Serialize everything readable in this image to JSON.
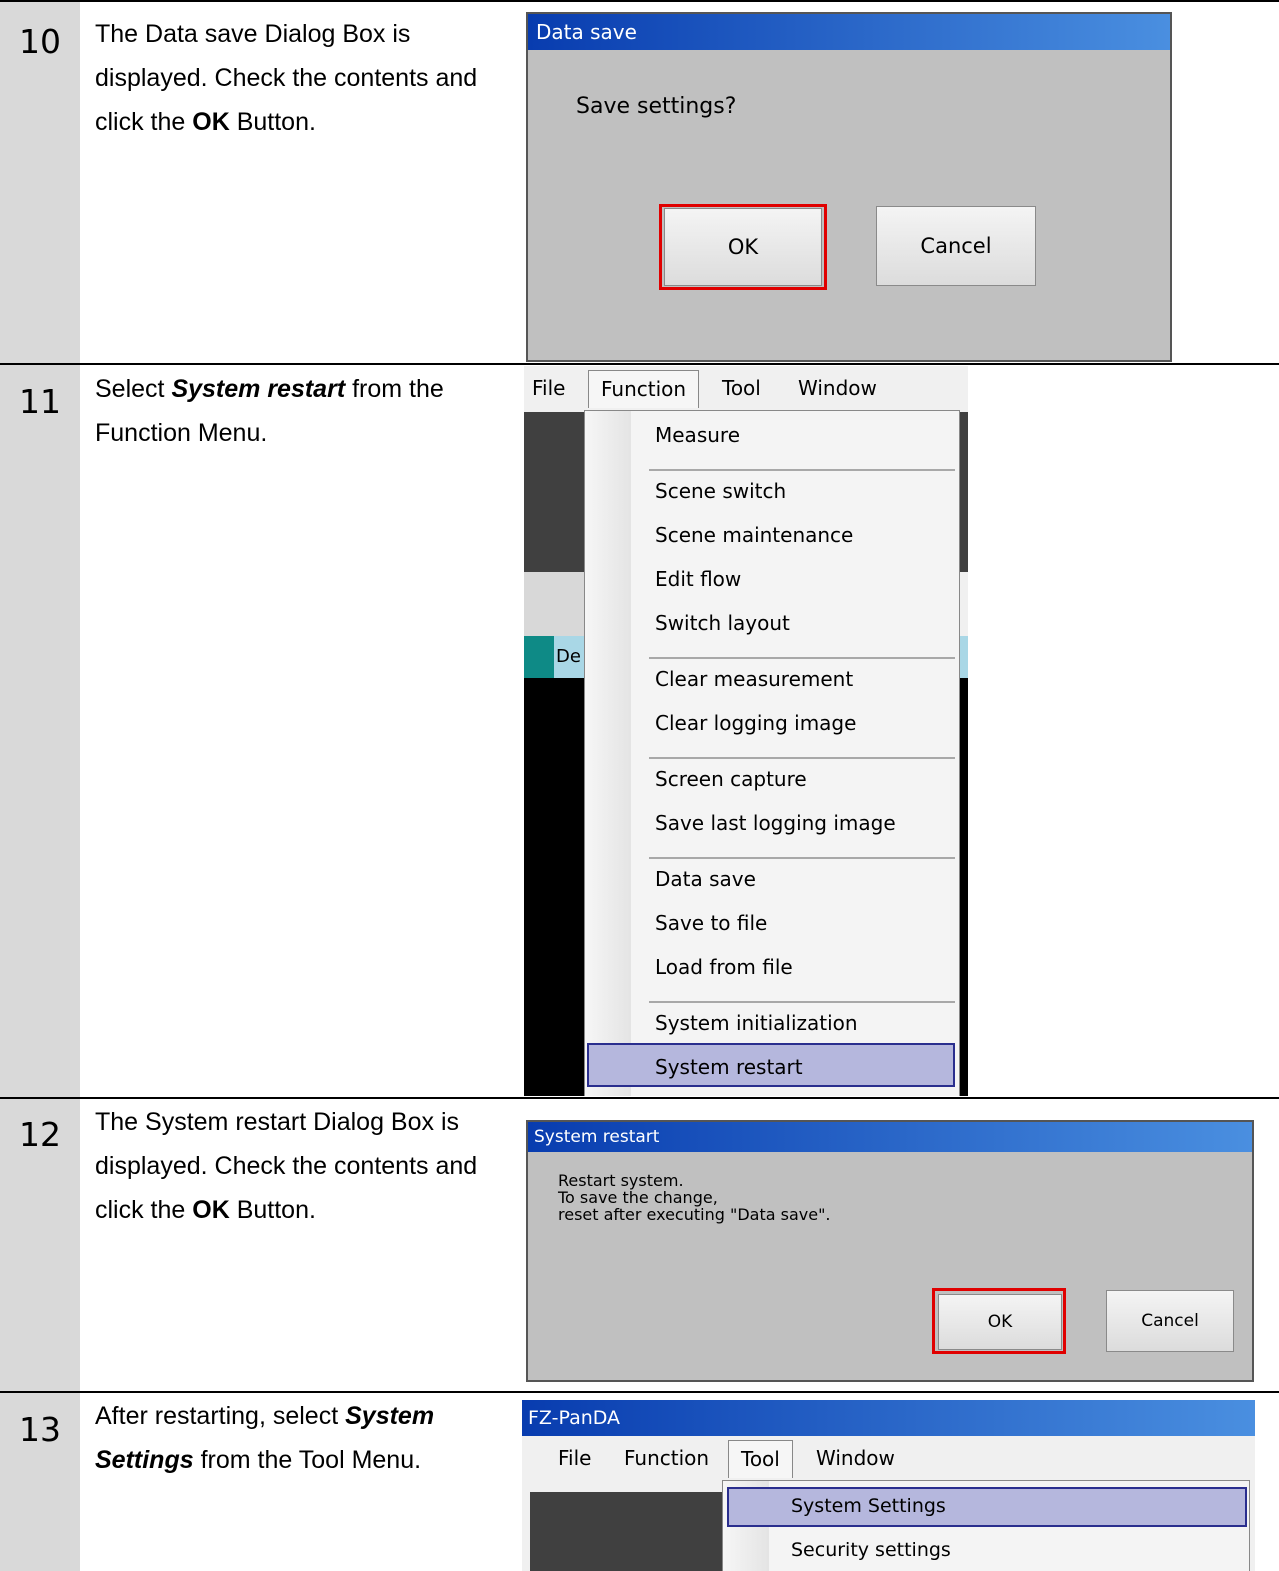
{
  "steps": [
    {
      "number": "10",
      "description": [
        {
          "t": "The Data save Dialog Box is displayed. Check the contents and click the "
        },
        {
          "t": "OK",
          "b": true
        },
        {
          "t": " Button."
        }
      ]
    },
    {
      "number": "11",
      "description": [
        {
          "t": "Select "
        },
        {
          "t": "System restart",
          "bi": true
        },
        {
          "t": " from the Function Menu."
        }
      ]
    },
    {
      "number": "12",
      "description": [
        {
          "t": "The System restart Dialog Box is displayed. Check the contents and click the "
        },
        {
          "t": "OK",
          "b": true
        },
        {
          "t": " Button."
        }
      ]
    },
    {
      "number": "13",
      "description": [
        {
          "t": "After restarting, select "
        },
        {
          "t": "System Settings",
          "bi": true
        },
        {
          "t": " from the Tool Menu."
        }
      ]
    }
  ],
  "dialog10": {
    "title": "Data save",
    "message": "Save settings?",
    "ok": "OK",
    "cancel": "Cancel"
  },
  "menu11": {
    "menubar": [
      "File",
      "Function",
      "Tool",
      "Window"
    ],
    "partial_label": "De",
    "groups": [
      [
        "Measure"
      ],
      [
        "Scene switch",
        "Scene maintenance",
        "Edit flow",
        "Switch layout"
      ],
      [
        "Clear measurement",
        "Clear logging image"
      ],
      [
        "Screen capture",
        "Save last logging image"
      ],
      [
        "Data save",
        "Save to file",
        "Load from file"
      ],
      [
        "System initialization",
        "System restart"
      ]
    ],
    "selected": "System restart"
  },
  "dialog12": {
    "title": "System restart",
    "message_lines": [
      "Restart system.",
      "To save the change,",
      "reset after executing \"Data save\"."
    ],
    "ok": "OK",
    "cancel": "Cancel"
  },
  "window13": {
    "title": "FZ-PanDA",
    "menubar": [
      "File",
      "Function",
      "Tool",
      "Window"
    ],
    "items": [
      "System Settings",
      "Security settings"
    ],
    "selected": "System Settings"
  },
  "colors": {
    "step_column": "#d9d9d9",
    "dialog_bg": "#c0c0c0",
    "titlebar_start": "#083caf",
    "titlebar_end": "#4a8fe0",
    "highlight_border": "#e00000",
    "menu_selection": "#b5b7dd"
  }
}
